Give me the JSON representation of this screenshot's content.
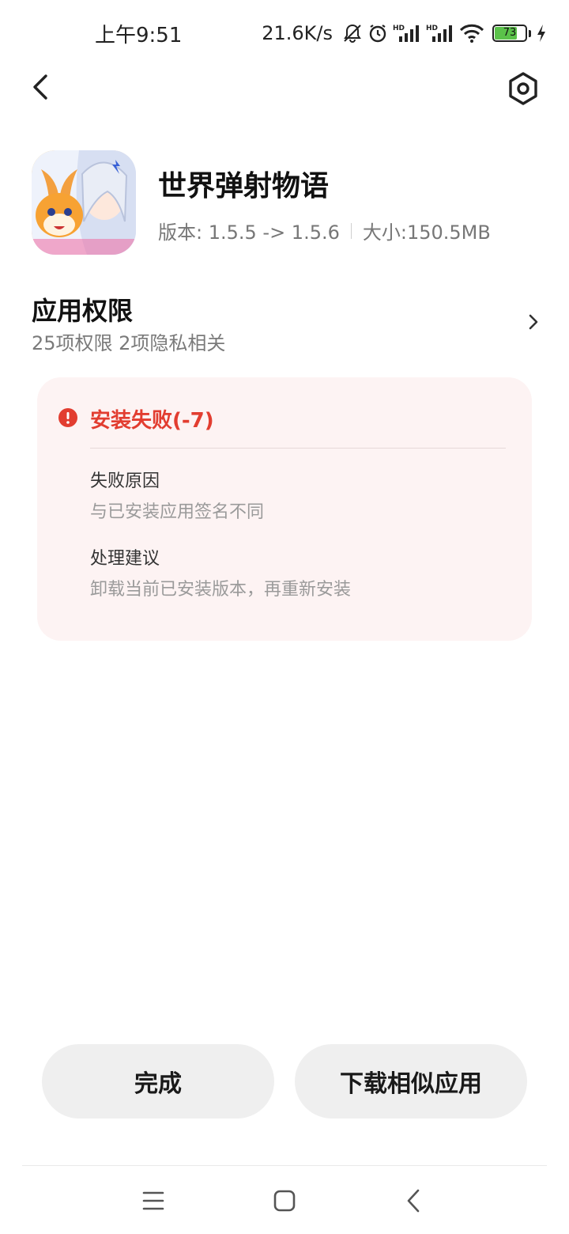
{
  "status_bar": {
    "time": "上午9:51",
    "net_speed": "21.6K/s",
    "battery_level": "73",
    "battery_fraction": 0.73
  },
  "app": {
    "name": "世界弹射物语",
    "version": "版本: 1.5.5 -> 1.5.6",
    "size": "大小:150.5MB"
  },
  "permissions": {
    "title": "应用权限",
    "summary": "25项权限 2项隐私相关"
  },
  "failure": {
    "title": "安装失败(-7)",
    "reason_label": "失败原因",
    "reason_text": "与已安装应用签名不同",
    "suggestion_label": "处理建议",
    "suggestion_text": "卸载当前已安装版本，再重新安装"
  },
  "buttons": {
    "done": "完成",
    "download_similar": "下载相似应用"
  },
  "colors": {
    "error": "#e23d30",
    "card_bg": "#fdf3f3",
    "button_bg": "#efefef",
    "battery_green": "#5bc24a"
  }
}
